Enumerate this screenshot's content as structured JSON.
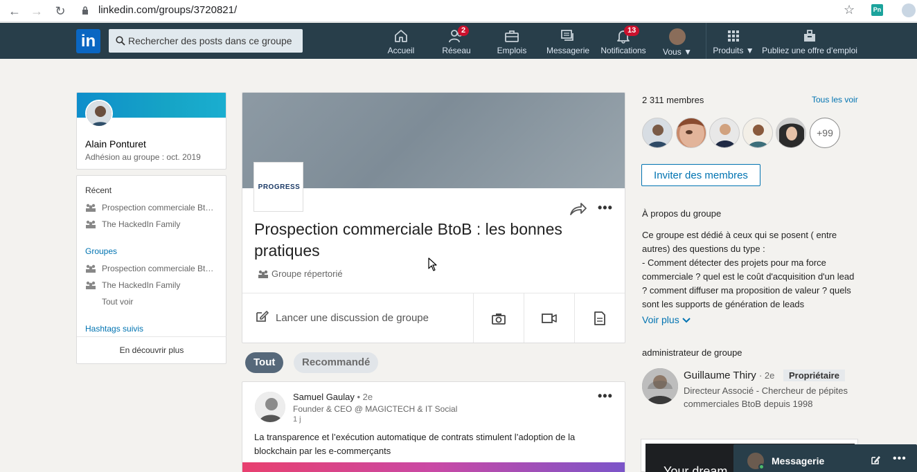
{
  "browser": {
    "url": "linkedin.com/groups/3720821/",
    "extension_label": "Pn"
  },
  "topbar": {
    "logo": "in",
    "search_placeholder": "Rechercher des posts dans ce groupe",
    "nav": {
      "home": "Accueil",
      "network": "Réseau",
      "network_badge": "2",
      "jobs": "Emplois",
      "messaging": "Messagerie",
      "notifications": "Notifications",
      "notifications_badge": "13",
      "me": "Vous",
      "products": "Produits",
      "post_job": "Publiez une offre d’emploi"
    }
  },
  "profile": {
    "name": "Alain Ponturet",
    "membership": "Adhésion au groupe : oct. 2019"
  },
  "left_nav": {
    "recent_title": "Récent",
    "recent_items": [
      "Prospection commerciale Bt…",
      "The HackedIn Family"
    ],
    "groups_title": "Groupes",
    "group_items": [
      "Prospection commerciale Bt…",
      "The HackedIn Family"
    ],
    "see_all": "Tout voir",
    "hashtags_title": "Hashtags suivis",
    "discover_more": "En découvrir plus"
  },
  "group": {
    "logo_text": "PROGRESS",
    "title": "Prospection commerciale BtoB : les bonnes pratiques",
    "type": "Groupe répertorié",
    "start_discussion": "Lancer une discussion de groupe"
  },
  "filters": {
    "all": "Tout",
    "recommended": "Recommandé"
  },
  "post": {
    "author": "Samuel Gaulay",
    "degree": "• 2e",
    "headline": "Founder & CEO @ MAGICTECH & IT Social",
    "time": "1 j",
    "text": "La transparence et l’exécution automatique de contrats stimulent l’adoption de la blockchain par les e-commerçants"
  },
  "members": {
    "count": "2 311 membres",
    "see_all": "Tous les voir",
    "more": "+99",
    "invite": "Inviter des membres"
  },
  "about": {
    "title": "À propos du groupe",
    "text": "Ce groupe est dédié à ceux qui se posent ( entre autres) des questions du type :\n- Comment détecter des projets pour ma force commerciale ? quel est le coût d'acquisition d'un lead ? comment diffuser ma proposition de valeur ? quels sont les supports de génération de leads",
    "see_more": "Voir plus"
  },
  "admin": {
    "title": "administrateur de groupe",
    "name": "Guillaume Thiry",
    "degree": "· 2e",
    "badge": "Propriétaire",
    "headline": "Directeur Associé - Chercheur de pépites commerciales BtoB depuis 1998"
  },
  "video_card": {
    "text": "Your dream"
  },
  "messaging": {
    "title": "Messagerie"
  },
  "colors": {
    "topbar": "#283e4a",
    "brand": "#0a66c2",
    "link": "#0073b1",
    "badge": "#cb112d"
  }
}
